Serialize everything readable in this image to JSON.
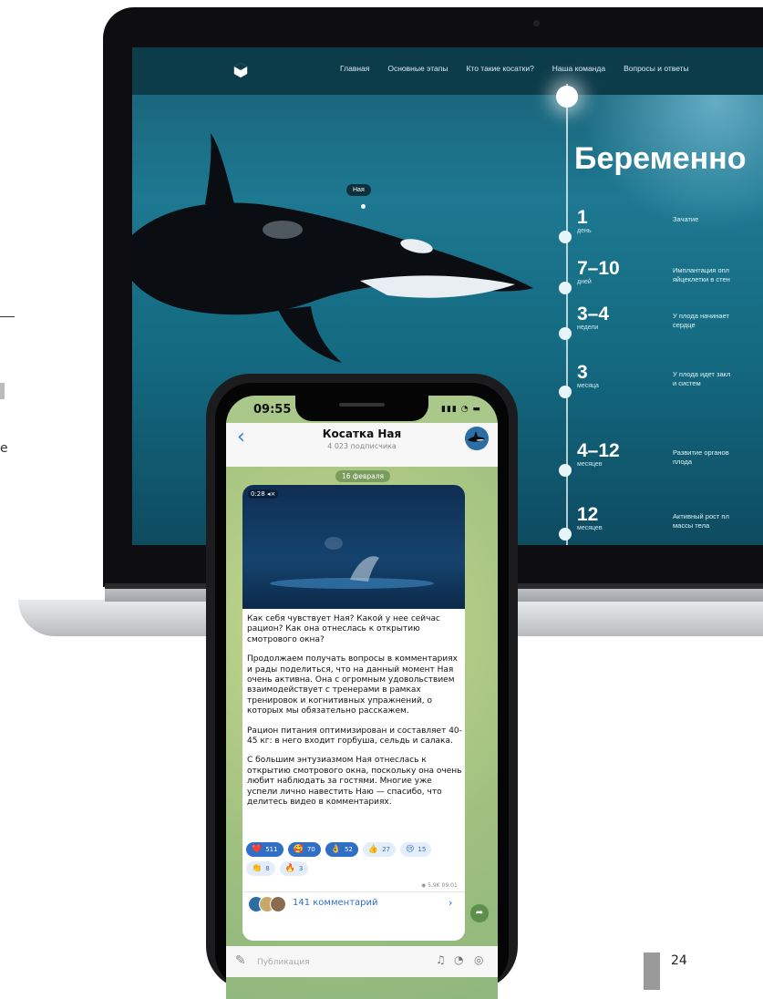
{
  "left_fragment": {
    "letter": "е"
  },
  "website": {
    "nav": [
      "Главная",
      "Основные этапы",
      "Кто такие косатки?",
      "Наша команда",
      "Вопросы и ответы"
    ],
    "orca_label": "Ная",
    "title": "Беременно",
    "timeline": [
      {
        "num": "1",
        "unit": "день",
        "desc": "Зачатие"
      },
      {
        "num": "7–10",
        "unit": "дней",
        "desc": "Имплантация опл\nяйцеклетки в стен"
      },
      {
        "num": "3–4",
        "unit": "недели",
        "desc": "У плода начинает\nсердце"
      },
      {
        "num": "3",
        "unit": "месяца",
        "desc": "У плода идет закл\nи систем"
      },
      {
        "num": "4–12",
        "unit": "месяцев",
        "desc": "Развитие органов\nплода"
      },
      {
        "num": "12",
        "unit": "месяцев",
        "desc": "Активный рост пл\nмассы тела"
      }
    ]
  },
  "phone": {
    "status": {
      "time": "09:55",
      "icons": "▮▮▮ ◔ ▬"
    },
    "header": {
      "title": "Косатка Ная",
      "subtitle": "4 023 подписчика",
      "back": "‹"
    },
    "date_badge": "16 февраля",
    "video_time": "0:28 ◂×",
    "post_paragraphs": [
      "Как себя чувствует Ная? Какой у нее сейчас рацион? Как она отнеслась к открытию смотрового окна?",
      "Продолжаем получать вопросы в комментариях и рады поделиться, что на данный момент Ная очень активна. Она с огромным удовольствием взаимодействует с тренерами в рамках тренировок и когнитивных упражнений, о которых мы обязательно расскажем.",
      "Рацион питания оптимизирован и составляет 40-45 кг: в него входит горбуша, сельдь и салака.",
      "С большим энтузиазмом Ная отнеслась к открытию смотрового окна, поскольку она очень любит наблюдать за гостями. Многие уже успели лично навестить Наю — спасибо, что делитесь видео в комментариях."
    ],
    "reactions": [
      {
        "emoji": "❤️",
        "count": "511",
        "active": true
      },
      {
        "emoji": "🥰",
        "count": "70",
        "active": true
      },
      {
        "emoji": "👌",
        "count": "52",
        "active": true
      },
      {
        "emoji": "👍",
        "count": "27",
        "active": false
      },
      {
        "emoji": "😢",
        "count": "15",
        "active": false
      },
      {
        "emoji": "👏",
        "count": "8",
        "active": false
      },
      {
        "emoji": "🔥",
        "count": "3",
        "active": false
      }
    ],
    "views": "◉ 5,9K 09:01",
    "comments_label": "141 комментарий",
    "comments_arrow": "›",
    "input_placeholder": "Публикация"
  },
  "page_number": "24",
  "colors": {
    "accent": "#2f6fc8",
    "nav_bg": "#0c3b4a"
  }
}
